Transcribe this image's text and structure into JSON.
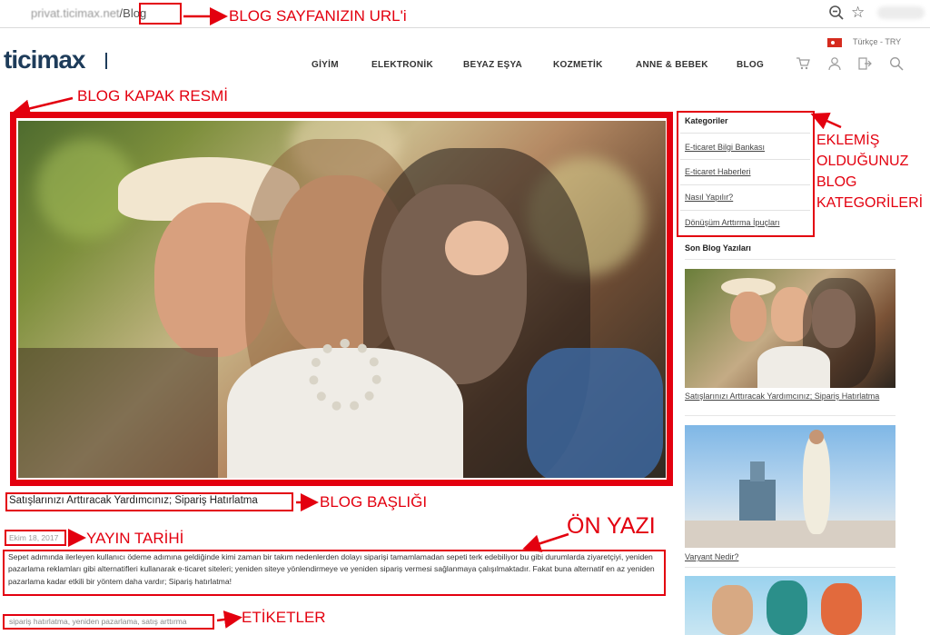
{
  "browser": {
    "url_blurred": "privat.ticimax.net",
    "url_path": "/Blog"
  },
  "site": {
    "logo": "ticimax",
    "language": "Türkçe - TRY",
    "nav": [
      "GİYİM",
      "ELEKTRONİK",
      "BEYAZ EŞYA",
      "KOZMETİK",
      "ANNE & BEBEK",
      "BLOG"
    ],
    "icons": [
      "cart-icon",
      "user-icon",
      "logout-icon",
      "search-icon"
    ]
  },
  "sidebar": {
    "categories_title": "Kategoriler",
    "categories": [
      "E-ticaret Bilgi Bankası",
      "E-ticaret Haberleri",
      "Nasıl Yapılır?",
      "Dönüşüm Arttırma İpuçları"
    ],
    "recent_title": "Son Blog Yazıları",
    "recent": [
      "Satışlarınızı Arttıracak Yardımcınız; Sipariş Hatırlatma",
      "Varyant Nedir?"
    ]
  },
  "post": {
    "title": "Satışlarınızı Arttıracak Yardımcınız; Sipariş Hatırlatma",
    "date": "Ekim 18, 2017",
    "excerpt": "Sepet adımında ilerleyen kullanıcı ödeme adımına geldiğinde kimi zaman bir takım nedenlerden dolayı siparişi tamamlamadan sepeti terk edebiliyor bu gibi durumlarda ziyaretçiyi, yeniden pazarlama reklamları gibi alternatifleri kullanarak e-ticaret siteleri; yeniden siteye yönlendirmeye  ve yeniden sipariş vermesi sağlanmaya çalışılmaktadır. Fakat buna alternatif en az yeniden pazarlama kadar etkili bir yöntem daha vardır; Sipariş hatırlatma!",
    "tags": "sipariş hatırlatma, yeniden pazarlama, satış arttırma"
  },
  "annotations": {
    "url": "BLOG SAYFANIZIN URL'i",
    "cover": "BLOG KAPAK RESMİ",
    "categories": "EKLEMİŞ OLDUĞUNUZ BLOG KATEGORİLERİ",
    "title": "BLOG BAŞLIĞI",
    "date": "YAYIN TARİHİ",
    "excerpt": "ÖN YAZI",
    "tags": "ETİKETLER"
  },
  "colors": {
    "annotation": "#e3000f",
    "logo": "#1e3c5a"
  }
}
